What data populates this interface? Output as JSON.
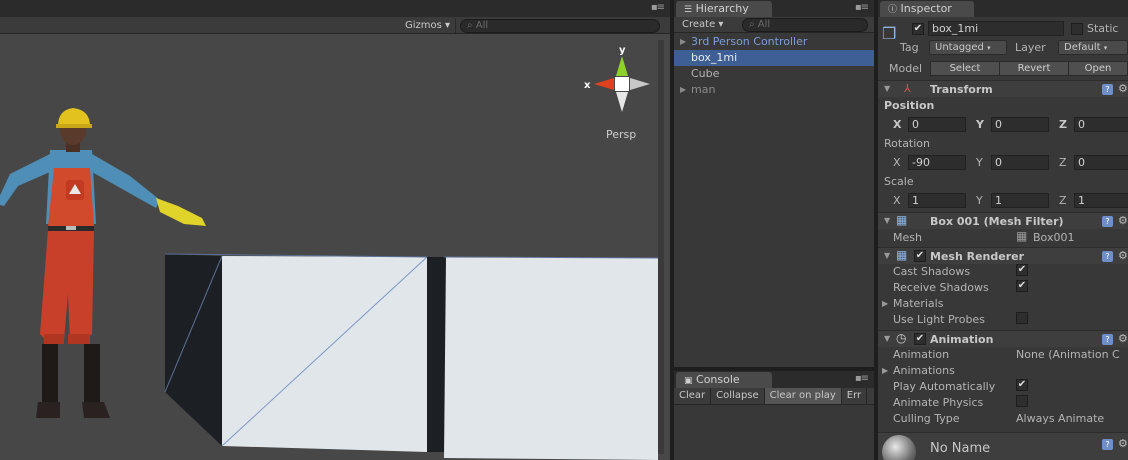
{
  "scene": {
    "gizmos_label": "Gizmos ▾",
    "search_placeholder": "All",
    "axis_x": "x",
    "axis_y": "y",
    "projection": "Persp"
  },
  "hierarchy": {
    "tab_label": "Hierarchy",
    "create_label": "Create ▾",
    "search_placeholder": "All",
    "items": [
      {
        "label": "3rd Person Controller",
        "state": "prefab-collapsed"
      },
      {
        "label": "box_1mi",
        "state": "selected"
      },
      {
        "label": "Cube",
        "state": "normal"
      },
      {
        "label": "man",
        "state": "collapsed-dim"
      }
    ]
  },
  "console": {
    "tab_label": "Console",
    "buttons": [
      "Clear",
      "Collapse",
      "Clear on play",
      "Err"
    ],
    "active_button": "Clear on play"
  },
  "inspector": {
    "tab_label": "Inspector",
    "object_name": "box_1mi",
    "static_label": "Static",
    "tag_label": "Tag",
    "tag_value": "Untagged",
    "layer_label": "Layer",
    "layer_value": "Default",
    "model_label": "Model",
    "model_buttons": [
      "Select",
      "Revert",
      "Open"
    ],
    "transform": {
      "title": "Transform",
      "position_label": "Position",
      "rotation_label": "Rotation",
      "scale_label": "Scale",
      "axis_x": "X",
      "axis_y": "Y",
      "axis_z": "Z",
      "position": [
        "0",
        "0",
        "0"
      ],
      "rotation": [
        "-90",
        "0",
        "0"
      ],
      "scale": [
        "1",
        "1",
        "1"
      ]
    },
    "mesh_filter": {
      "title": "Box 001 (Mesh Filter)",
      "mesh_label": "Mesh",
      "mesh_value": "Box001"
    },
    "mesh_renderer": {
      "title": "Mesh Renderer",
      "cast_shadows": "Cast Shadows",
      "receive_shadows": "Receive Shadows",
      "materials": "Materials",
      "use_light_probes": "Use Light Probes"
    },
    "animation": {
      "title": "Animation",
      "animation_label": "Animation",
      "animation_value": "None (Animation C",
      "animations_label": "Animations",
      "play_automatically": "Play Automatically",
      "animate_physics": "Animate Physics",
      "culling_type_label": "Culling Type",
      "culling_type_value": "Always Animate"
    },
    "material": {
      "title": "No Name"
    }
  },
  "colors": {
    "scene_bg": "#474747",
    "panel_bg": "#383838",
    "selection": "#3e5f96",
    "prefab_text": "#7b9edc",
    "axis_x": "#e0421f",
    "axis_y": "#8fd12a"
  }
}
